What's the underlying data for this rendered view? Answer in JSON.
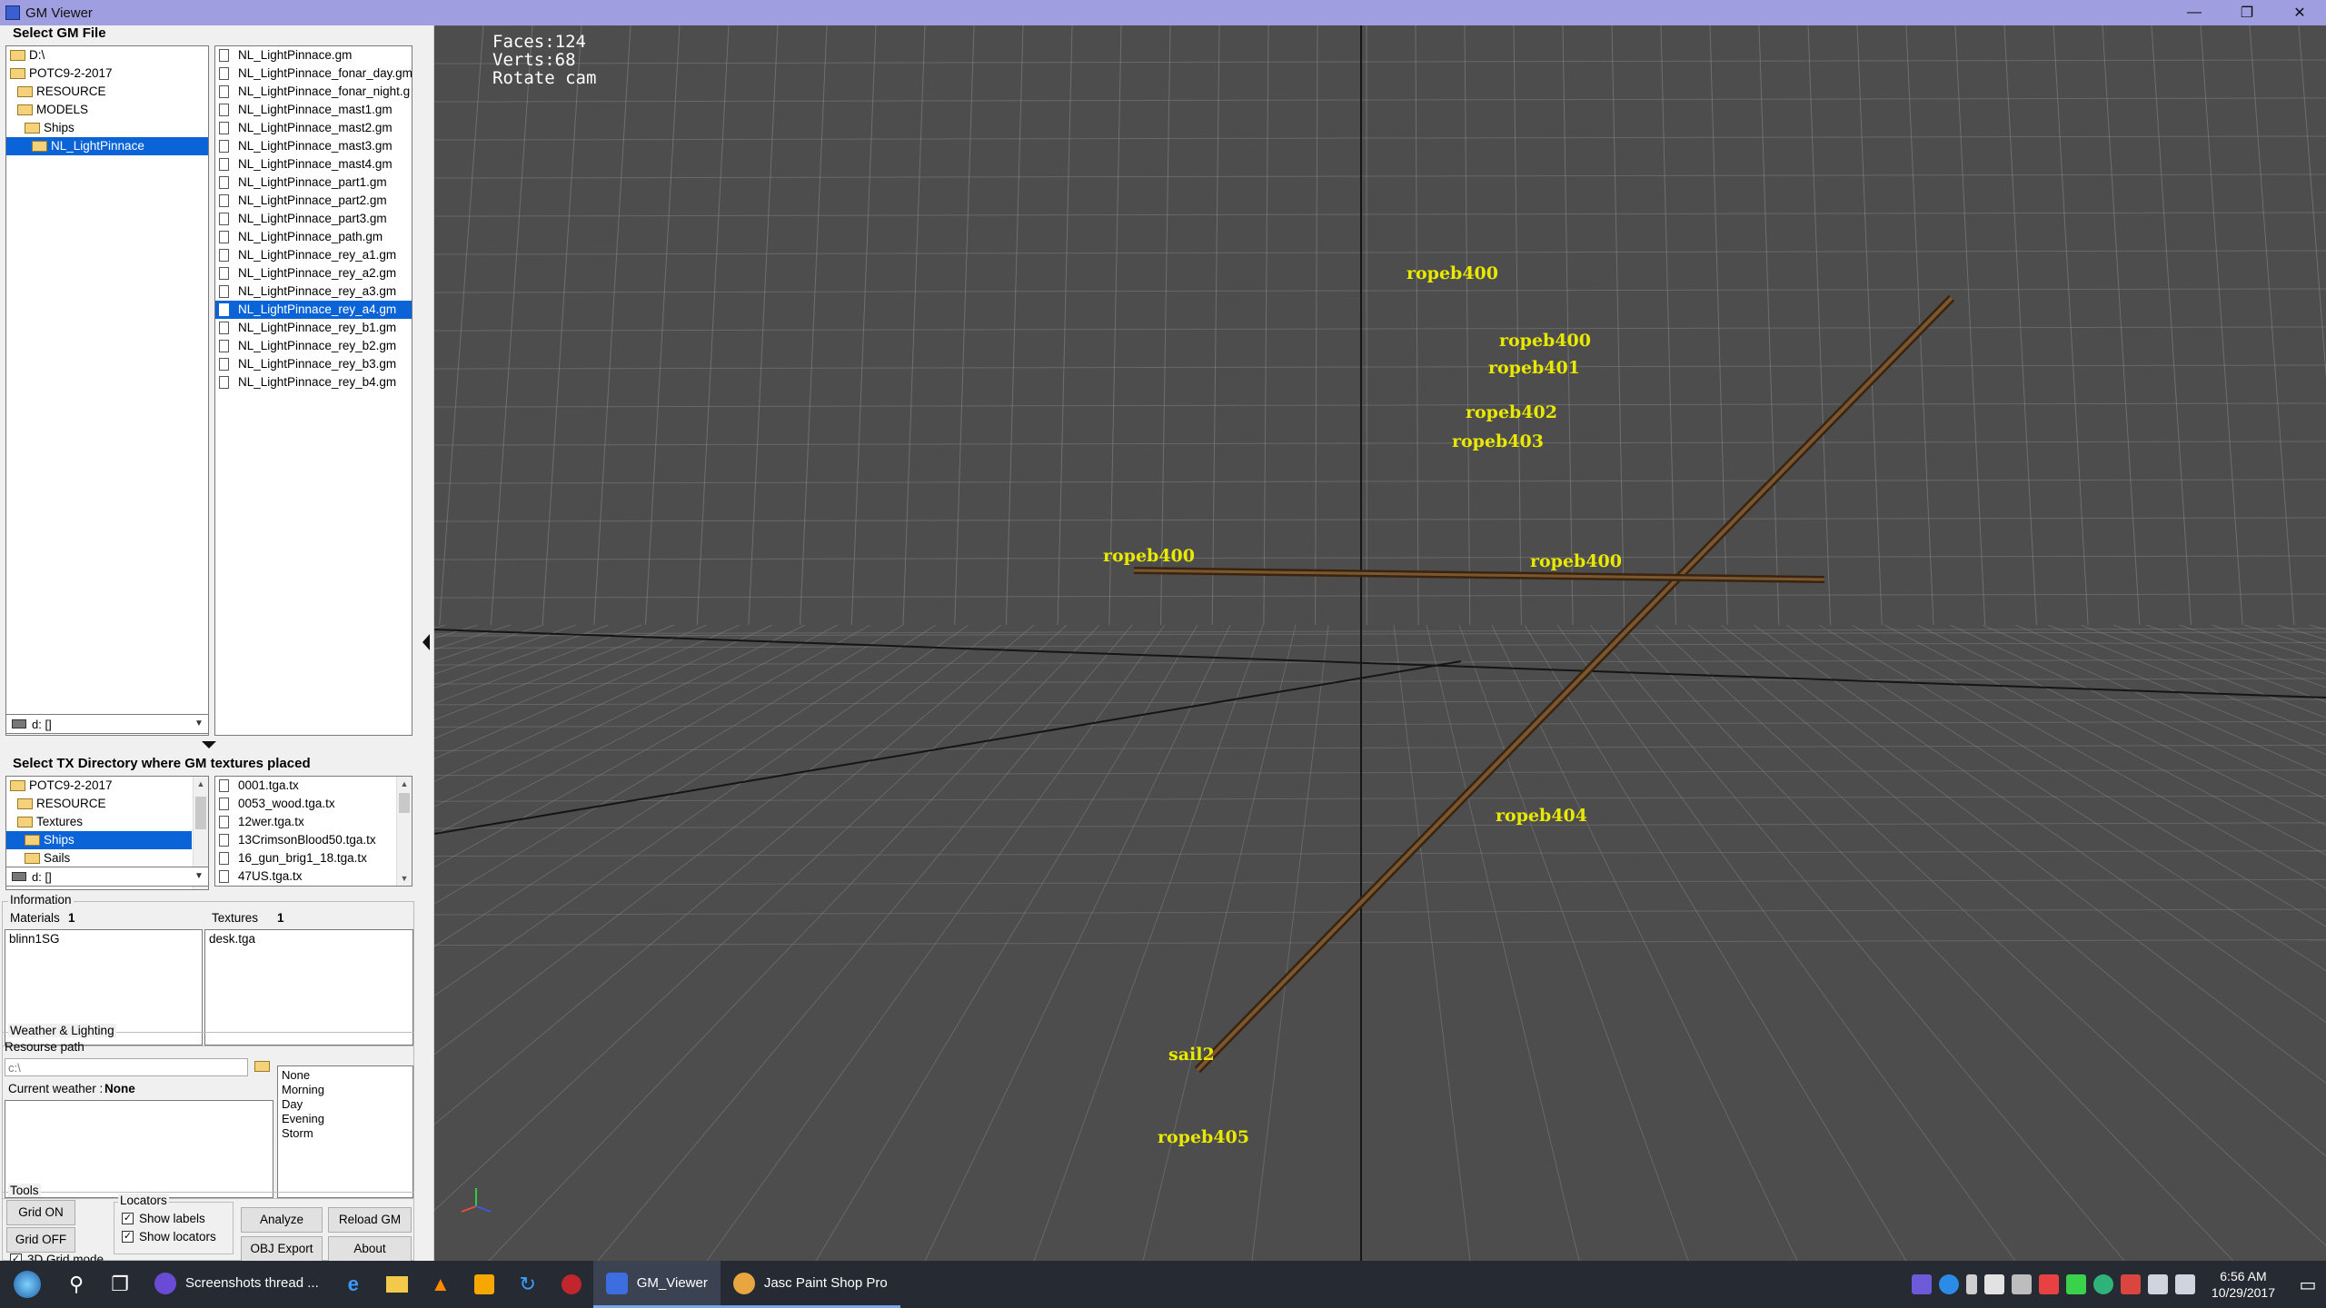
{
  "window": {
    "title": "GM Viewer",
    "min": "—",
    "restore": "❐",
    "close": "✕"
  },
  "gm_panel": {
    "title": "Select GM File",
    "tree": [
      "D:\\",
      "POTC9-2-2017",
      "RESOURCE",
      "MODELS",
      "Ships",
      "NL_LightPinnace"
    ],
    "tree_selected": 5,
    "drive": "d: []",
    "files": [
      "NL_LightPinnace.gm",
      "NL_LightPinnace_fonar_day.gm",
      "NL_LightPinnace_fonar_night.g",
      "NL_LightPinnace_mast1.gm",
      "NL_LightPinnace_mast2.gm",
      "NL_LightPinnace_mast3.gm",
      "NL_LightPinnace_mast4.gm",
      "NL_LightPinnace_part1.gm",
      "NL_LightPinnace_part2.gm",
      "NL_LightPinnace_part3.gm",
      "NL_LightPinnace_path.gm",
      "NL_LightPinnace_rey_a1.gm",
      "NL_LightPinnace_rey_a2.gm",
      "NL_LightPinnace_rey_a3.gm",
      "NL_LightPinnace_rey_a4.gm",
      "NL_LightPinnace_rey_b1.gm",
      "NL_LightPinnace_rey_b2.gm",
      "NL_LightPinnace_rey_b3.gm",
      "NL_LightPinnace_rey_b4.gm"
    ],
    "file_selected": 14
  },
  "tx_panel": {
    "title": "Select TX Directory where GM textures placed",
    "tree": [
      "POTC9-2-2017",
      "RESOURCE",
      "Textures",
      "Ships",
      "Sails"
    ],
    "tree_selected": 3,
    "drive": "d: []",
    "files": [
      "0001.tga.tx",
      "0053_wood.tga.tx",
      "12wer.tga.tx",
      "13CrimsonBlood50.tga.tx",
      "16_gun_brig1_18.tga.tx",
      "47US.tga.tx"
    ]
  },
  "information": {
    "legend": "Information",
    "materials_label": "Materials",
    "materials_count": "1",
    "textures_label": "Textures",
    "textures_count": "1",
    "materials": [
      "blinn1SG"
    ],
    "textures": [
      "desk.tga"
    ]
  },
  "weather": {
    "legend": "Weather & Lighting",
    "resource_path_label": "Resourse path",
    "resource_path_placeholder": "c:\\",
    "current_label": "Current weather :",
    "current_value": "None",
    "options": [
      "None",
      "Morning",
      "Day",
      "Evening",
      "Storm"
    ]
  },
  "tools": {
    "legend": "Tools",
    "grid_on": "Grid ON",
    "grid_off": "Grid OFF",
    "grid3d": "3D Grid mode",
    "locators_legend": "Locators",
    "show_labels": "Show labels",
    "show_locators": "Show locators",
    "analyze": "Analyze",
    "reload": "Reload GM",
    "obj_export": "OBJ Export",
    "about": "About"
  },
  "viewport": {
    "stats": [
      "Faces:124",
      "Verts:68",
      "Rotate cam"
    ],
    "bg_color": "#4d4d4d",
    "label_color": "#e9e900",
    "labels": [
      "ropeb400",
      "ropeb400",
      "ropeb401",
      "ropeb402",
      "ropeb403",
      "ropeb400",
      "ropeb400",
      "ropeb404",
      "sail2",
      "ropeb405"
    ]
  },
  "taskbar": {
    "apps": [
      "Screenshots thread ...",
      "GM_Viewer",
      "Jasc Paint Shop Pro"
    ],
    "time": "6:56 AM",
    "date": "10/29/2017"
  }
}
